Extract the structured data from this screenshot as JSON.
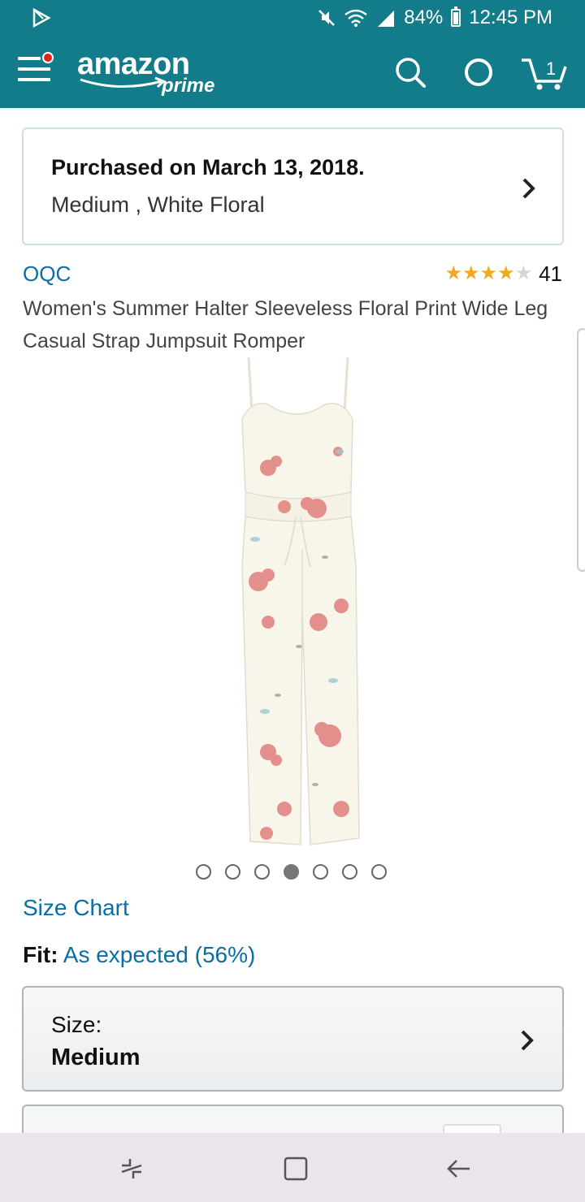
{
  "status_bar": {
    "battery": "84%",
    "time": "12:45 PM",
    "icons": [
      "play-store-notification-icon",
      "mute-icon",
      "wifi-icon",
      "signal-icon",
      "battery-icon"
    ]
  },
  "header": {
    "logo_word": "amazon",
    "logo_sub": "prime",
    "cart_count": "1",
    "icons": [
      "menu-icon",
      "search-icon",
      "alexa-icon",
      "cart-icon"
    ],
    "color": "#137c8b"
  },
  "purchase": {
    "line1": "Purchased on March 13, 2018.",
    "line2": "Medium , White Floral"
  },
  "product": {
    "brand": "OQC",
    "rating_stars": 4,
    "rating_max": 5,
    "review_count": "41",
    "title": "Women's Summer Halter Sleeveless Floral Print Wide Leg Casual Strap Jumpsuit Romper",
    "image_count": 7,
    "active_image_index": 3
  },
  "size_chart_link": "Size Chart",
  "fit": {
    "label": "Fit:",
    "value": "As expected (56%)"
  },
  "size_selector": {
    "label": "Size:",
    "value": "Medium"
  },
  "colors": {
    "link": "#0b6ea3",
    "star": "#f4a81d"
  },
  "nav_bar": {
    "icons": [
      "recent-apps-icon",
      "home-icon",
      "back-icon"
    ]
  }
}
